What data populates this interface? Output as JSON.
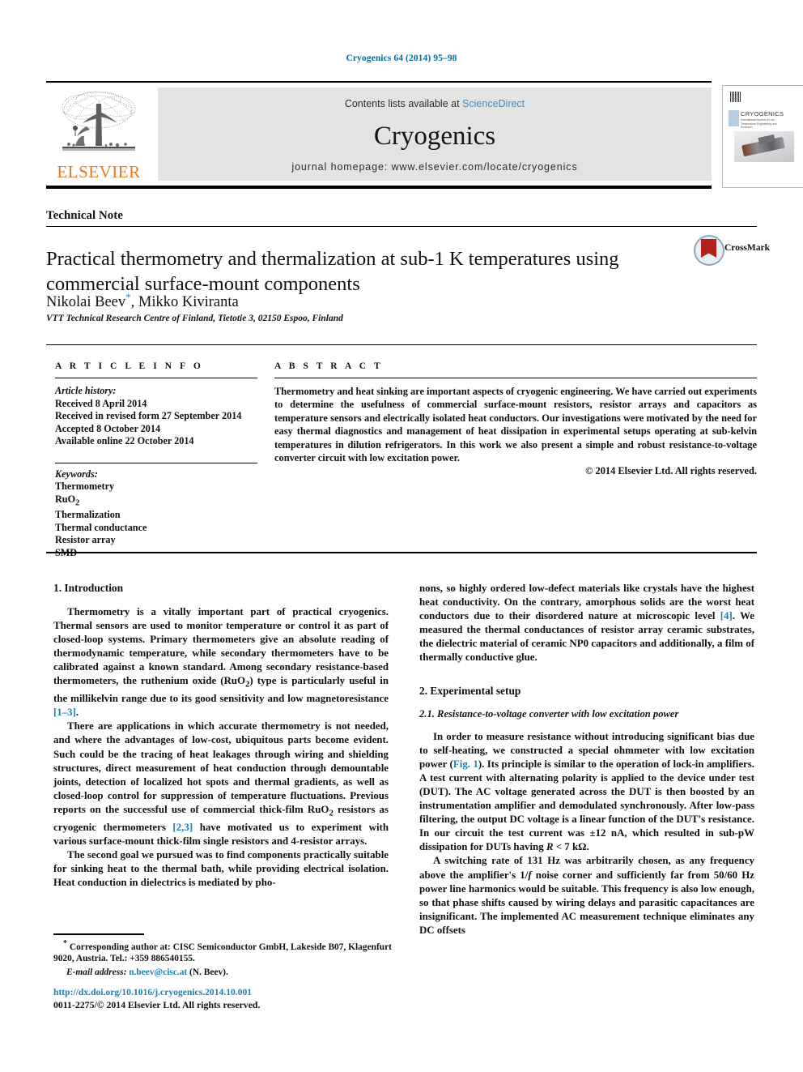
{
  "running_head": "Cryogenics 64 (2014) 95–98",
  "masthead": {
    "contents_prefix": "Contents lists available at",
    "sciencedirect": "ScienceDirect",
    "journal_name": "Cryogenics",
    "homepage": "journal homepage: www.elsevier.com/locate/cryogenics",
    "publisher_wordmark": "ELSEVIER",
    "cover": {
      "title": "CRYOGENICS",
      "subtitle": "International Journal of Low Temperature Engineering and Research"
    }
  },
  "article": {
    "doctype": "Technical Note",
    "title": "Practical thermometry and thermalization at sub-1 K temperatures using commercial surface-mount components",
    "authors": "Nikolai Beev",
    "authors_rest": ", Mikko Kiviranta",
    "corresponding_marker": "*",
    "affiliation": "VTT Technical Research Centre of Finland, Tietotie 3, 02150 Espoo, Finland",
    "crossmark_label": "CrossMark"
  },
  "info": {
    "heading": "A R T I C L E    I N F O",
    "history_label": "Article history:",
    "history": [
      "Received 8 April 2014",
      "Received in revised form 27 September 2014",
      "Accepted 8 October 2014",
      "Available online 22 October 2014"
    ],
    "keywords_label": "Keywords:",
    "keywords": [
      "Thermometry",
      "RuO2",
      "Thermalization",
      "Thermal conductance",
      "Resistor array",
      "SMD"
    ]
  },
  "abstract": {
    "heading": "A B S T R A C T",
    "text": "Thermometry and heat sinking are important aspects of cryogenic engineering. We have carried out experiments to determine the usefulness of commercial surface-mount resistors, resistor arrays and capacitors as temperature sensors and electrically isolated heat conductors. Our investigations were motivated by the need for easy thermal diagnostics and management of heat dissipation in experimental setups operating at sub-kelvin temperatures in dilution refrigerators. In this work we also present a simple and robust resistance-to-voltage converter circuit with low excitation power.",
    "copyright": "© 2014 Elsevier Ltd. All rights reserved."
  },
  "body": {
    "sec1_heading": "1. Introduction",
    "sec1_p1_a": "Thermometry is a vitally important part of practical cryogenics. Thermal sensors are used to monitor temperature or control it as part of closed-loop systems. Primary thermometers give an absolute reading of thermodynamic temperature, while secondary thermometers have to be calibrated against a known standard. Among secondary resistance-based thermometers, the ruthenium oxide (RuO",
    "sec1_p1_sub": "2",
    "sec1_p1_b": ") type is particularly useful in the millikelvin range due to its good sensitivity and low magnetoresistance ",
    "sec1_p1_ref": "[1–3]",
    "sec1_p1_c": ".",
    "sec1_p2_a": "There are applications in which accurate thermometry is not needed, and where the advantages of low-cost, ubiquitous parts become evident. Such could be the tracing of heat leakages through wiring and shielding structures, direct measurement of heat conduction through demountable joints, detection of localized hot spots and thermal gradients, as well as closed-loop control for suppression of temperature fluctuations. Previous reports on the successful use of commercial thick-film RuO",
    "sec1_p2_sub": "2",
    "sec1_p2_b": " resistors as cryogenic thermometers ",
    "sec1_p2_ref": "[2,3]",
    "sec1_p2_c": " have motivated us to experiment with various surface-mount thick-film single resistors and 4-resistor arrays.",
    "sec1_p3": "The second goal we pursued was to find components practically suitable for sinking heat to the thermal bath, while providing electrical isolation. Heat conduction in dielectrics is mediated by pho-",
    "sec1_p3_cont_a": "nons, so highly ordered low-defect materials like crystals have the highest heat conductivity. On the contrary, amorphous solids are the worst heat conductors due to their disordered nature at microscopic level ",
    "sec1_p3_cont_ref": "[4]",
    "sec1_p3_cont_b": ". We measured the thermal conductances of resistor array ceramic substrates, the dielectric material of ceramic NP0 capacitors and additionally, a film of thermally conductive glue.",
    "sec2_heading": "2. Experimental setup",
    "sec21_heading": "2.1. Resistance-to-voltage converter with low excitation power",
    "sec21_p1_a": "In order to measure resistance without introducing significant bias due to self-heating, we constructed a special ohmmeter with low excitation power (",
    "sec21_p1_ref": "Fig. 1",
    "sec21_p1_b": "). Its principle is similar to the operation of lock-in amplifiers. A test current with alternating polarity is applied to the device under test (DUT). The AC voltage generated across the DUT is then boosted by an instrumentation amplifier and demodulated synchronously. After low-pass filtering, the output DC voltage is a linear function of the DUT's resistance. In our circuit the test current was ±12 nA, which resulted in sub-pW dissipation for DUTs having ",
    "sec21_p1_italic": "R",
    "sec21_p1_c": " < 7 kΩ.",
    "sec21_p2_a": "A switching rate of 131 Hz was arbitrarily chosen, as any frequency above the amplifier's 1/",
    "sec21_p2_italic": "f",
    "sec21_p2_b": " noise corner and sufficiently far from 50/60 Hz power line harmonics would be suitable. This frequency is also low enough, so that phase shifts caused by wiring delays and parasitic capacitances are insignificant. The implemented AC measurement technique eliminates any DC offsets"
  },
  "footer": {
    "corresponding_star": "*",
    "corresponding_text": "Corresponding author at: CISC Semiconductor GmbH, Lakeside B07, Klagenfurt 9020, Austria. Tel.: +359 886540155.",
    "email_label": "E-mail address:",
    "email": "n.beev@cisc.at",
    "email_suffix": "(N. Beev).",
    "doi": "http://dx.doi.org/10.1016/j.cryogenics.2014.10.001",
    "issn": "0011-2275/© 2014 Elsevier Ltd. All rights reserved."
  },
  "colors": {
    "link": "#1a7fb5",
    "running_head": "#0a6a9a",
    "elsevier_orange": "#E87722",
    "sciencedirect": "#3a8dc4",
    "band_bg": "#e3e3e3"
  }
}
